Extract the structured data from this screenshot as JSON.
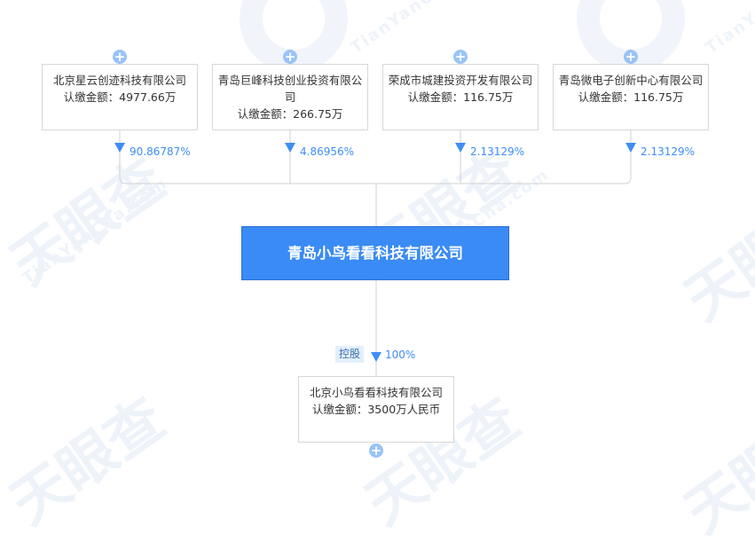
{
  "shareholders": [
    {
      "name": "北京星云创迹科技有限公司",
      "amount_label": "认缴金额：4977.66万",
      "percent": "90.86787%"
    },
    {
      "name": "青岛巨峰科技创业投资有限公司",
      "amount_label": "认缴金额：266.75万",
      "percent": "4.86956%"
    },
    {
      "name": "荣成市城建投资开发有限公司",
      "amount_label": "认缴金额：116.75万",
      "percent": "2.13129%"
    },
    {
      "name": "青岛微电子创新中心有限公司",
      "amount_label": "认缴金额：116.75万",
      "percent": "2.13129%"
    }
  ],
  "company": {
    "name": "青岛小鸟看看科技有限公司"
  },
  "subsidiary": {
    "relation_tag": "控股",
    "percent": "100%",
    "name": "北京小鸟看看科技有限公司",
    "amount_label": "认缴金额：3500万人民币"
  },
  "watermark": {
    "text": "天眼查",
    "domain": "TianYanCha.com"
  },
  "colors": {
    "primary": "#3a8bf5",
    "plus": "#99c3f7",
    "line": "#d0d0d0"
  },
  "icons": {
    "expand": "plus-circle-icon",
    "arrow": "arrow-down-icon"
  }
}
